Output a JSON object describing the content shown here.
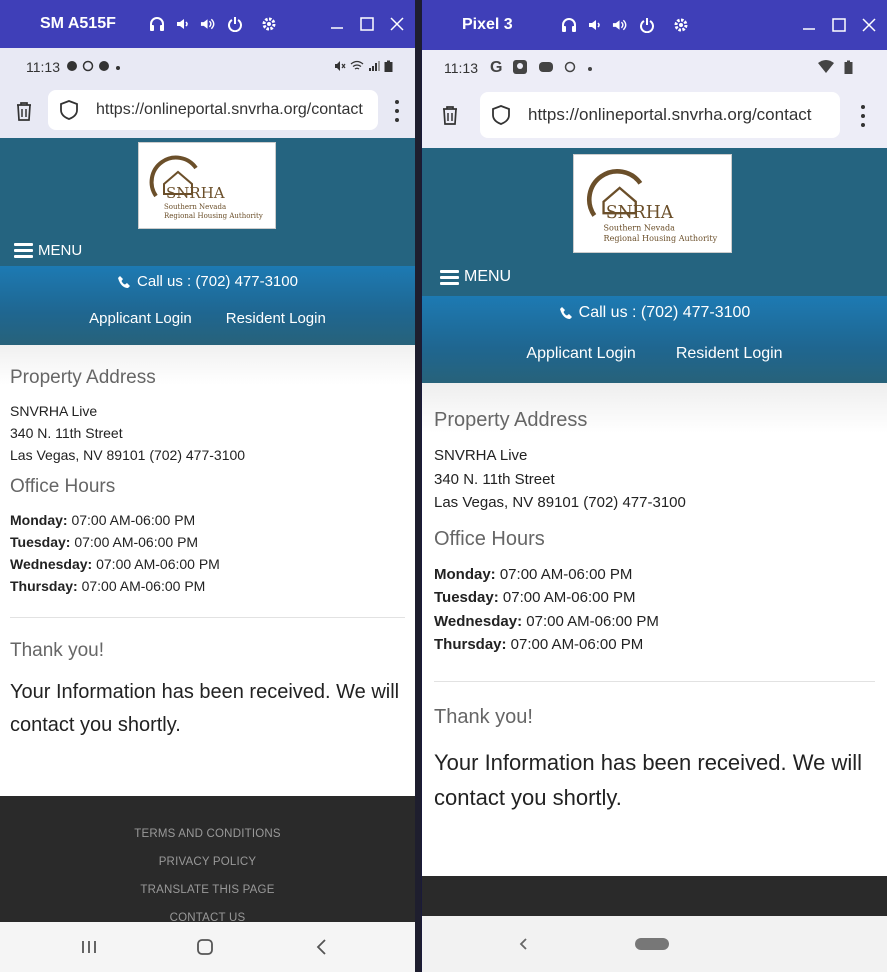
{
  "devices": [
    {
      "name": "SM A515F",
      "clock": "11:13",
      "url": "https://onlineportal.snvrha.org/contact"
    },
    {
      "name": "Pixel 3",
      "clock": "11:13",
      "url": "https://onlineportal.snvrha.org/contact"
    }
  ],
  "site": {
    "logo_text": "SNRHA",
    "logo_subtitle_1": "Southern Nevada",
    "logo_subtitle_2": "Regional Housing Authority",
    "menu_label": "MENU",
    "call_us": "Call us : (702) 477-3100",
    "applicant_login": "Applicant Login",
    "resident_login": "Resident Login"
  },
  "content": {
    "property_heading": "Property Address",
    "address_line1": "SNVRHA Live",
    "address_line2": "340 N. 11th Street",
    "address_line3": "Las Vegas, NV 89101 (702) 477-3100",
    "office_heading": "Office Hours",
    "hours": [
      {
        "day": "Monday:",
        "time": " 07:00 AM-06:00 PM"
      },
      {
        "day": "Tuesday:",
        "time": " 07:00 AM-06:00 PM"
      },
      {
        "day": "Wednesday:",
        "time": " 07:00 AM-06:00 PM"
      },
      {
        "day": "Thursday:",
        "time": " 07:00 AM-06:00 PM"
      }
    ],
    "thanks_heading": "Thank you!",
    "received_message": "Your Information has been received. We will contact you shortly."
  },
  "footer": {
    "links": [
      "TERMS AND CONDITIONS",
      "PRIVACY POLICY",
      "TRANSLATE THIS PAGE",
      "CONTACT US"
    ]
  },
  "colors": {
    "titlebar": "#3f3fb8",
    "header": "#256480",
    "callbar": "#1f6690",
    "footer": "#2a2a2a"
  }
}
